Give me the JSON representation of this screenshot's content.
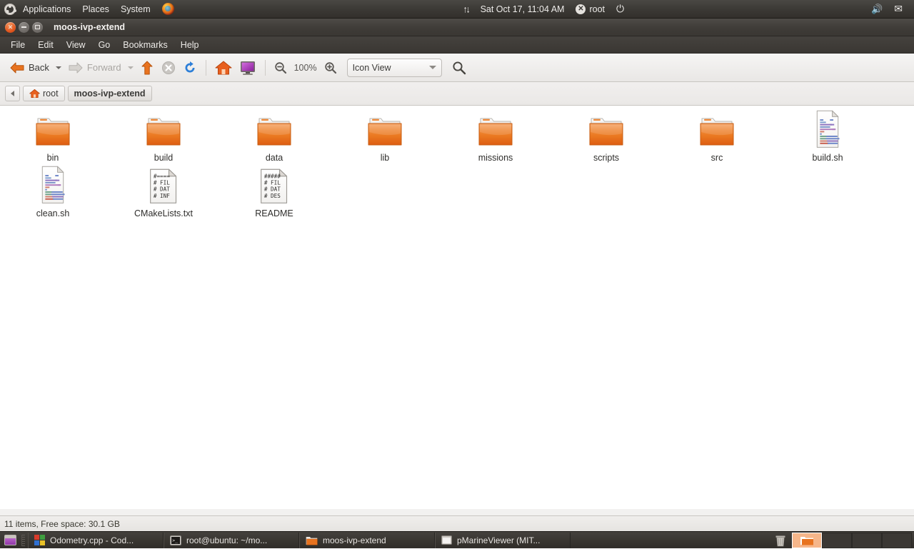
{
  "top_panel": {
    "logo_icon": "ubuntu-logo-icon",
    "menus": [
      "Applications",
      "Places",
      "System"
    ],
    "firefox_icon": "firefox-icon",
    "network_icon": "network-updown-icon",
    "clock": "Sat Oct 17, 11:04 AM",
    "user": "root",
    "user_icon": "user-status-icon",
    "power_icon": "power-icon",
    "volume_icon": "volume-icon",
    "mail_icon": "mail-icon"
  },
  "window": {
    "title": "moos-ivp-extend",
    "buttons": {
      "close": "close-button",
      "minimize": "minimize-button",
      "maximize": "maximize-button"
    },
    "menubar": [
      "File",
      "Edit",
      "View",
      "Go",
      "Bookmarks",
      "Help"
    ]
  },
  "toolbar": {
    "back_label": "Back",
    "forward_label": "Forward",
    "up_icon": "arrow-up-icon",
    "stop_icon": "stop-icon",
    "reload_icon": "reload-icon",
    "home_icon": "home-icon",
    "computer_icon": "computer-icon",
    "zoom_out_icon": "zoom-out-icon",
    "zoom_level": "100%",
    "zoom_in_icon": "zoom-in-icon",
    "view_mode": "Icon View",
    "search_icon": "search-icon"
  },
  "pathbar": {
    "scroll_left_icon": "chevron-left-icon",
    "crumbs": [
      {
        "label": "root",
        "icon": "home-icon",
        "current": false
      },
      {
        "label": "moos-ivp-extend",
        "icon": "",
        "current": true
      }
    ]
  },
  "files": [
    {
      "name": "bin",
      "type": "folder"
    },
    {
      "name": "build",
      "type": "folder"
    },
    {
      "name": "data",
      "type": "folder"
    },
    {
      "name": "lib",
      "type": "folder"
    },
    {
      "name": "missions",
      "type": "folder"
    },
    {
      "name": "scripts",
      "type": "folder"
    },
    {
      "name": "src",
      "type": "folder"
    },
    {
      "name": "build.sh",
      "type": "script"
    },
    {
      "name": "clean.sh",
      "type": "script"
    },
    {
      "name": "CMakeLists.txt",
      "type": "text",
      "preview": [
        "#====",
        "# FIL",
        "# DAT",
        "# INF"
      ]
    },
    {
      "name": "README",
      "type": "text",
      "preview": [
        "#####",
        "# FIL",
        "# DAT",
        "# DES"
      ]
    }
  ],
  "statusbar": {
    "text": "11 items, Free space: 30.1 GB"
  },
  "taskbar": {
    "show_desktop_icon": "show-desktop-icon",
    "tasks": [
      {
        "label": "Odometry.cpp - Cod...",
        "icon": "codeblocks-icon"
      },
      {
        "label": "root@ubuntu: ~/mo...",
        "icon": "terminal-icon"
      },
      {
        "label": "moos-ivp-extend",
        "icon": "folder-icon"
      },
      {
        "label": "pMarineViewer (MIT...",
        "icon": "window-icon"
      }
    ],
    "trash_icon": "trash-icon",
    "workspaces": [
      {
        "active": true,
        "icon": "folder-icon"
      },
      {
        "active": false,
        "icon": ""
      },
      {
        "active": false,
        "icon": ""
      },
      {
        "active": false,
        "icon": ""
      }
    ]
  },
  "colors": {
    "panel_bg": "#3c3a36",
    "folder_orange": "#e8731f",
    "content_bg": "#ffffff",
    "chrome_bg": "#f2f1f0"
  }
}
